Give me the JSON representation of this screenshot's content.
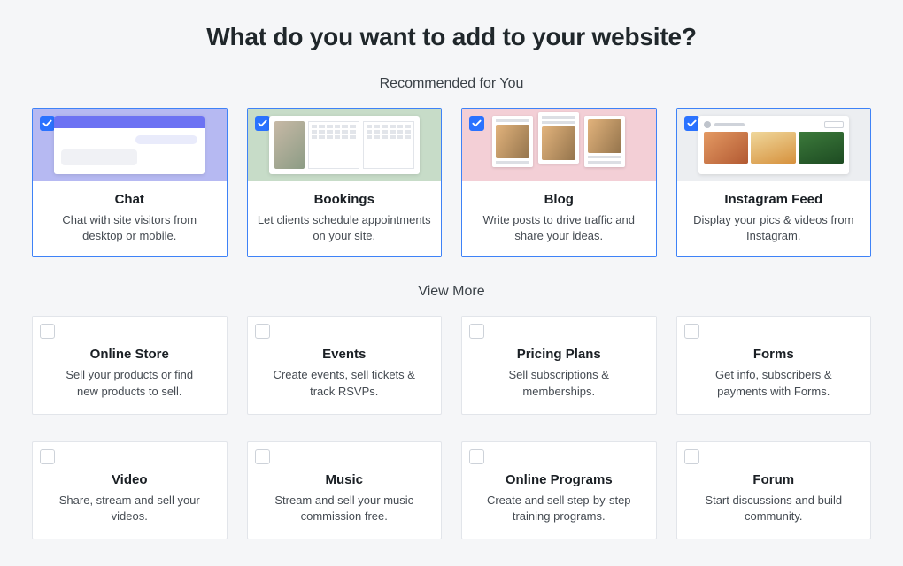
{
  "title": "What do you want to add to your website?",
  "recommended_label": "Recommended for You",
  "view_more_label": "View More",
  "recommended": [
    {
      "id": "chat",
      "title": "Chat",
      "desc": "Chat with site visitors from desktop or mobile.",
      "selected": true
    },
    {
      "id": "bookings",
      "title": "Bookings",
      "desc": "Let clients schedule appointments on your site.",
      "selected": true
    },
    {
      "id": "blog",
      "title": "Blog",
      "desc": "Write posts to drive traffic and share your ideas.",
      "selected": true
    },
    {
      "id": "instagram-feed",
      "title": "Instagram Feed",
      "desc": "Display your pics & videos from Instagram.",
      "selected": true
    }
  ],
  "more": [
    {
      "id": "online-store",
      "title": "Online Store",
      "desc": "Sell your products or find new products to sell.",
      "selected": false
    },
    {
      "id": "events",
      "title": "Events",
      "desc": "Create events, sell tickets & track RSVPs.",
      "selected": false
    },
    {
      "id": "pricing-plans",
      "title": "Pricing Plans",
      "desc": "Sell subscriptions & memberships.",
      "selected": false
    },
    {
      "id": "forms",
      "title": "Forms",
      "desc": "Get info, subscribers & payments with Forms.",
      "selected": false
    },
    {
      "id": "video",
      "title": "Video",
      "desc": "Share, stream and sell your videos.",
      "selected": false
    },
    {
      "id": "music",
      "title": "Music",
      "desc": "Stream and sell your music commission free.",
      "selected": false
    },
    {
      "id": "online-programs",
      "title": "Online Programs",
      "desc": "Create and sell step-by-step training programs.",
      "selected": false
    },
    {
      "id": "forum",
      "title": "Forum",
      "desc": "Start discussions and build community.",
      "selected": false
    }
  ]
}
